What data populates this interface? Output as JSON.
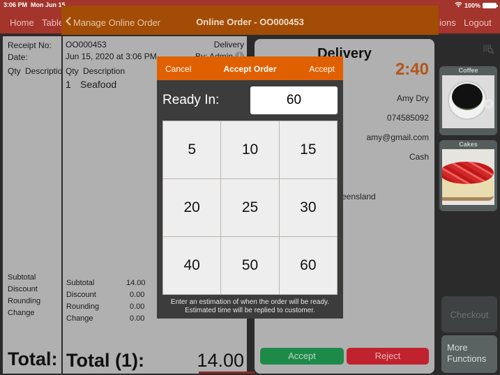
{
  "status_bar": {
    "time": "3:06 PM",
    "date": "Mon Jun 15",
    "battery": "100%"
  },
  "nav": {
    "home": "Home",
    "table": "Table",
    "functions_partial": "ions",
    "logout": "Logout"
  },
  "overlay_header": {
    "back_label": "Manage Online Order",
    "title": "Online Order - OO000453"
  },
  "receipt_left": {
    "receipt_no_label": "Receipt No:",
    "date_label": "Date:",
    "qty_label": "Qty",
    "desc_label": "Descriptio",
    "subtotal": "Subtotal",
    "discount": "Discount",
    "rounding": "Rounding",
    "change": "Change",
    "total": "Total:"
  },
  "receipt_main": {
    "receipt_no": "OO000453",
    "order_type": "Delivery",
    "date": "Jun 15, 2020 at 3:06 PM",
    "by": "By: Admin",
    "qty_header": "Qty",
    "desc_header": "Description",
    "items": [
      {
        "qty": "1",
        "description": "Seafood"
      }
    ],
    "summary": [
      {
        "label": "Subtotal",
        "value": "14.00"
      },
      {
        "label": "Discount",
        "value": "0.00"
      },
      {
        "label": "Rounding",
        "value": "0.00"
      },
      {
        "label": "Change",
        "value": "0.00"
      }
    ],
    "total_label": "Total (1):",
    "total_value": "14.00"
  },
  "detail": {
    "title": "Delivery",
    "timer": "2:40",
    "name": "Amy Dry",
    "phone": "074585092",
    "email": "amy@gmail.com",
    "payment": "Cash",
    "address_partial": "eensland",
    "accept_button": "Accept",
    "reject_button": "Reject",
    "colors": {
      "accept": "#1e8a4a",
      "reject": "#c0222e",
      "timer": "#b5541a"
    }
  },
  "categories": [
    {
      "label": "Coffee"
    },
    {
      "label": "Cakes"
    }
  ],
  "functions": {
    "checkout": "Checkout",
    "more_functions": "More Functions"
  },
  "dialog": {
    "cancel": "Cancel",
    "title": "Accept Order",
    "accept": "Accept",
    "ready_label": "Ready In:",
    "ready_value": "60",
    "keys": [
      "5",
      "10",
      "15",
      "20",
      "25",
      "30",
      "40",
      "50",
      "60"
    ],
    "hint_line1": "Enter an estimation of when the order will be ready.",
    "hint_line2": "Estimated time will be replied to customer.",
    "header_color": "#e06000"
  }
}
